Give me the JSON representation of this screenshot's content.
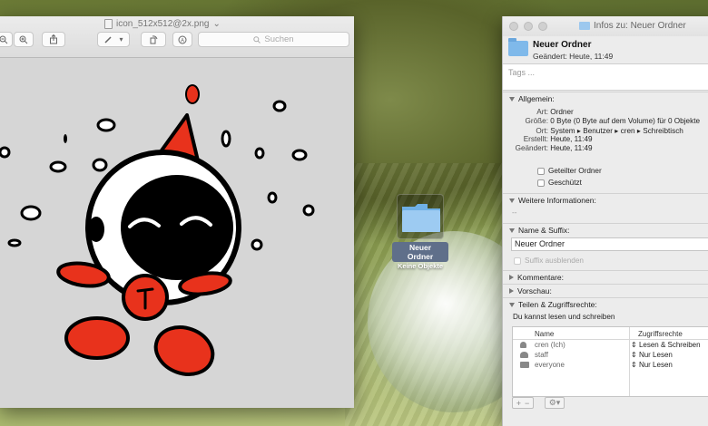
{
  "preview": {
    "title": "icon_512x512@2x.png",
    "title_chevron": "⌄",
    "search_placeholder": "Suchen",
    "icons": [
      "zoom-out-icon",
      "zoom-in-icon",
      "share-icon",
      "markup-pen-icon",
      "rotate-icon",
      "annotate-icon"
    ]
  },
  "desktop_folder": {
    "name": "Neuer Ordner",
    "subtitle": "Keine Objekte"
  },
  "info": {
    "window_title": "Infos zu: Neuer Ordner",
    "name": "Neuer Ordner",
    "modified": "Geändert: Heute, 11:49",
    "tags_placeholder": "Tags ...",
    "sections": {
      "general": "Allgemein:",
      "more_info": "Weitere Informationen:",
      "name_ext": "Name & Suffix:",
      "comments": "Kommentare:",
      "preview": "Vorschau:",
      "sharing": "Teilen & Zugriffsrechte:"
    },
    "general": [
      {
        "key": "Art:",
        "value": "Ordner"
      },
      {
        "key": "Größe:",
        "value": "0 Byte (0 Byte auf dem Volume) für 0 Objekte"
      },
      {
        "key": "Ort:",
        "value": "System ▸ Benutzer ▸ cren ▸ Schreibtisch"
      },
      {
        "key": "Erstellt:",
        "value": "Heute, 11:49"
      },
      {
        "key": "Geändert:",
        "value": "Heute, 11:49"
      }
    ],
    "shared_folder": "Geteilter Ordner",
    "locked": "Geschützt",
    "more_info_value": "--",
    "name_field_value": "Neuer Ordner",
    "hide_extension": "Suffix ausblenden",
    "sharing_note": "Du kannst lesen und schreiben",
    "perm_columns": {
      "name": "Name",
      "rights": "Zugriffsrechte"
    },
    "perm_rows": [
      {
        "name": "cren (Ich)",
        "rights": "Lesen & Schreiben",
        "icon": "user-icon"
      },
      {
        "name": "staff",
        "rights": "Nur Lesen",
        "icon": "group-icon"
      },
      {
        "name": "everyone",
        "rights": "Nur Lesen",
        "icon": "everyone-icon"
      }
    ],
    "bottom_buttons": {
      "add": "+",
      "remove": "−",
      "action": "⚙▾"
    }
  },
  "colors": {
    "mascot_red": "#e8321c",
    "folder_blue": "#7fb9ea"
  }
}
